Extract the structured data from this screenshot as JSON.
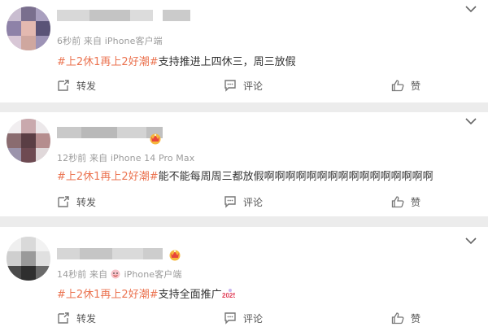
{
  "posts": [
    {
      "time": "6秒前",
      "source_prefix": "来自",
      "source": "iPhone客户端",
      "hashtag": "#上2休1再上2好潮#",
      "text": "支持推进上四休三，周三放假",
      "repost_label": "转发",
      "comment_label": "评论",
      "like_label": "赞"
    },
    {
      "time": "12秒前",
      "source_prefix": "来自",
      "source": "iPhone 14 Pro Max",
      "hashtag": "#上2休1再上2好潮#",
      "text": "能不能每周周三都放假啊啊啊啊啊啊啊啊啊啊啊啊啊啊啊啊",
      "repost_label": "转发",
      "comment_label": "评论",
      "like_label": "赞"
    },
    {
      "time": "14秒前",
      "source_prefix": "来自",
      "source": "iPhone客户端",
      "hashtag": "#上2休1再上2好潮#",
      "text": "支持全面推广",
      "repost_label": "转发",
      "comment_label": "评论",
      "like_label": "赞"
    }
  ],
  "colors": {
    "hashtag": "#eb7350",
    "meta": "#9b9b9b",
    "text": "#333333",
    "background": "#ececec"
  },
  "icons": {
    "repost": "repost-icon",
    "comment": "comment-icon",
    "like": "thumbs-up-icon",
    "menu": "chevron-down-icon",
    "badge": "crown-badge-icon"
  }
}
